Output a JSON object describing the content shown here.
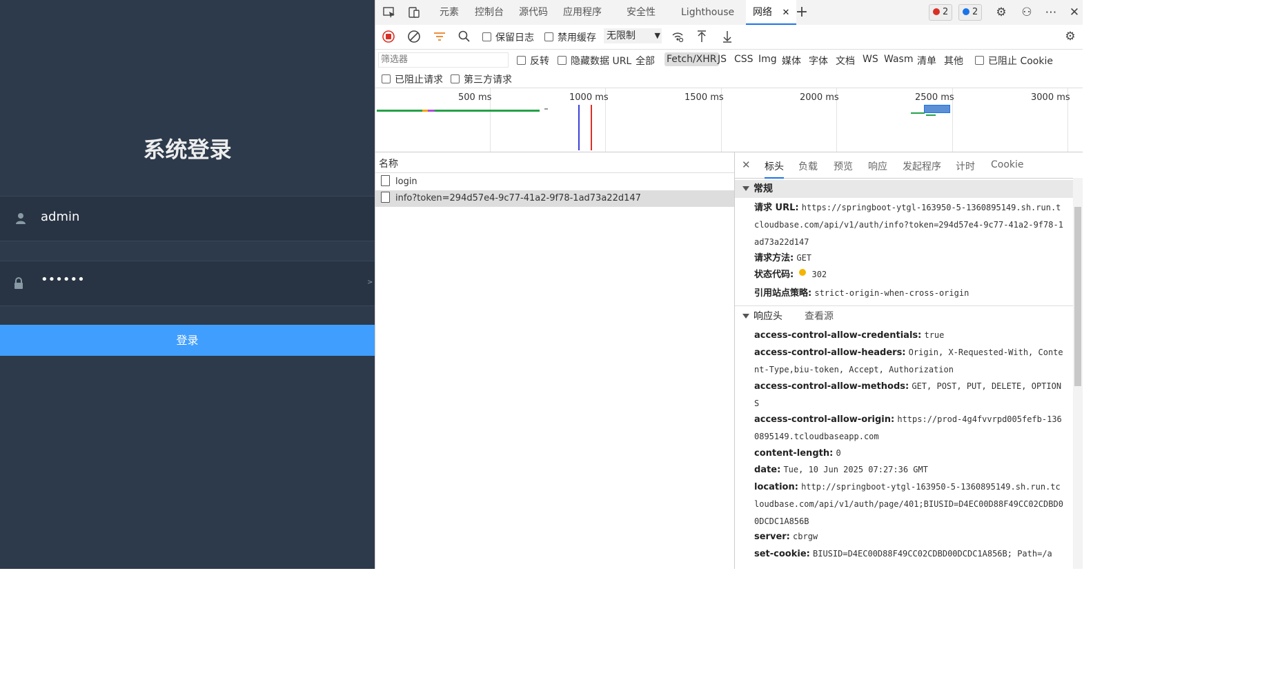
{
  "login": {
    "title": "系统登录",
    "username": "admin",
    "password": "••••••",
    "submit_label": "登录",
    "bg_color": "#2d3a4b",
    "button_color": "#409eff"
  },
  "devtools": {
    "tabs": [
      "元素",
      "控制台",
      "源代码",
      "应用程序",
      "安全性",
      "Lighthouse",
      "网络"
    ],
    "active_tab": "网络",
    "errors_count": "2",
    "messages_count": "2",
    "toolbar": {
      "preserve_log": "保留日志",
      "disable_cache": "禁用缓存",
      "throttle": "无限制"
    },
    "filter": {
      "placeholder": "筛选器",
      "invert": "反转",
      "hide_data_urls": "隐藏数据 URL",
      "types": [
        "全部",
        "Fetch/XHR",
        "JS",
        "CSS",
        "Img",
        "媒体",
        "字体",
        "文档",
        "WS",
        "Wasm",
        "清单",
        "其他"
      ],
      "active_type": "Fetch/XHR",
      "blocked_cookies": "已阻止 Cookie",
      "blocked_requests": "已阻止请求",
      "third_party": "第三方请求"
    },
    "timeline_labels": [
      "500 ms",
      "1000 ms",
      "1500 ms",
      "2000 ms",
      "2500 ms",
      "3000 ms"
    ],
    "request_list": {
      "header": "名称",
      "rows": [
        "login",
        "info?token=294d57e4-9c77-41a2-9f78-1ad73a22d147"
      ],
      "selected": 1
    },
    "detail": {
      "tabs": [
        "标头",
        "负载",
        "预览",
        "响应",
        "发起程序",
        "计时",
        "Cookie"
      ],
      "active_tab": "标头",
      "general_title": "常规",
      "general": [
        {
          "k": "请求 URL:",
          "v": "https://springboot-ytgl-163950-5-1360895149.sh.run.tcloudbase.com/api/v1/auth/info?token=294d57e4-9c77-41a2-9f78-1ad73a22d147"
        },
        {
          "k": "请求方法:",
          "v": "GET"
        },
        {
          "k": "状态代码:",
          "v": "302"
        },
        {
          "k": "引用站点策略:",
          "v": "strict-origin-when-cross-origin"
        }
      ],
      "response_title": "响应头",
      "view_source": "查看源",
      "response_headers": [
        {
          "k": "access-control-allow-credentials:",
          "v": "true"
        },
        {
          "k": "access-control-allow-headers:",
          "v": "Origin, X-Requested-With, Content-Type,biu-token, Accept, Authorization"
        },
        {
          "k": "access-control-allow-methods:",
          "v": "GET, POST, PUT, DELETE, OPTIONS"
        },
        {
          "k": "access-control-allow-origin:",
          "v": "https://prod-4g4fvvrpd005fefb-1360895149.tcloudbaseapp.com"
        },
        {
          "k": "content-length:",
          "v": "0"
        },
        {
          "k": "date:",
          "v": "Tue, 10 Jun 2025 07:27:36 GMT"
        },
        {
          "k": "location:",
          "v": "http://springboot-ytgl-163950-5-1360895149.sh.run.tcloudbase.com/api/v1/auth/page/401;BIUSID=D4EC00D88F49CC02CDBD00DCDC1A856B"
        },
        {
          "k": "server:",
          "v": "cbrgw"
        },
        {
          "k": "set-cookie:",
          "v": "BIUSID=D4EC00D88F49CC02CDBD00DCDC1A856B; Path=/a"
        }
      ]
    }
  }
}
